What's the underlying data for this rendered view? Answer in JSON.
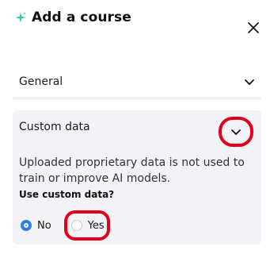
{
  "dialog": {
    "title": "Add a course",
    "close_icon": "close-icon",
    "sparkle_icon": "sparkle-icon",
    "accent": "#2ec4b6"
  },
  "sections": {
    "general": {
      "label": "General",
      "icon": "chevron-down-icon"
    },
    "custom": {
      "label": "Custom data",
      "icon": "chevron-down-icon",
      "description": "Uploaded proprietary data is not used to train or improve AI models.",
      "question": "Use custom data?",
      "options": [
        {
          "label": "No",
          "selected": true
        },
        {
          "label": "Yes",
          "selected": false
        }
      ]
    }
  },
  "colors": {
    "highlight": "#e0001b",
    "radio_selected": "#2f7fe8",
    "card_bg": "#f3f3f7"
  }
}
